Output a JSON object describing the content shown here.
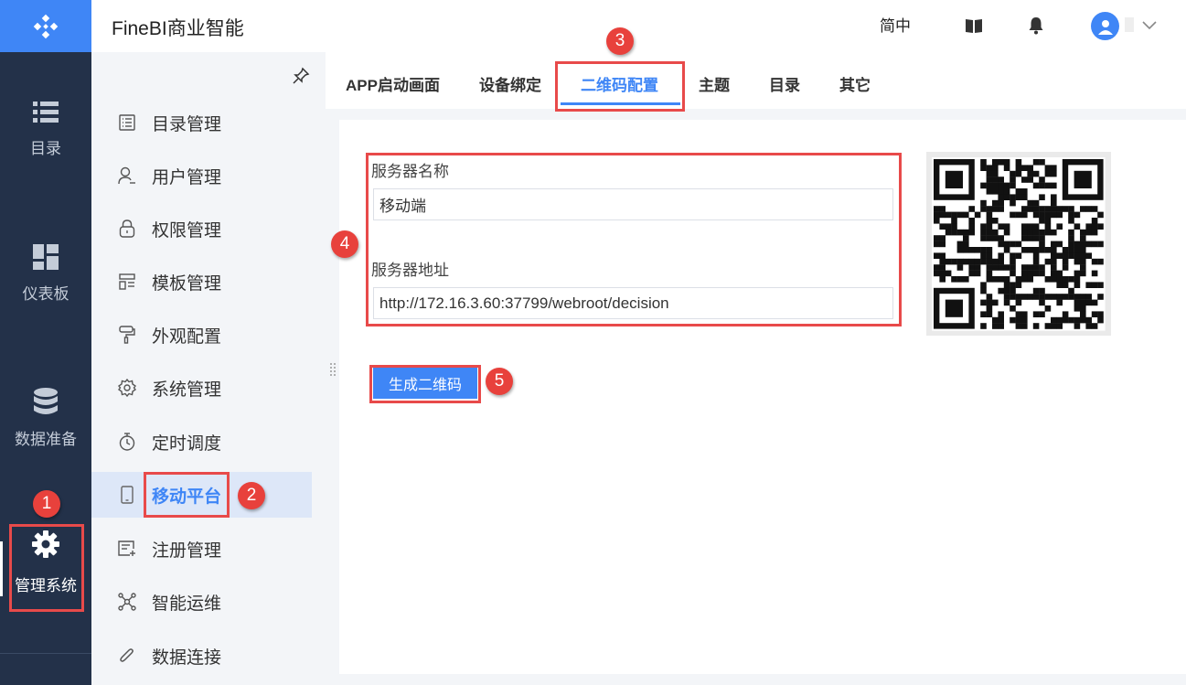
{
  "header": {
    "app_title": "FineBI商业智能",
    "lang": "简中"
  },
  "rail": {
    "items": [
      {
        "label": "目录",
        "icon": "list-icon"
      },
      {
        "label": "仪表板",
        "icon": "dashboard-icon"
      },
      {
        "label": "数据准备",
        "icon": "database-icon"
      },
      {
        "label": "管理系统",
        "icon": "gear-icon"
      }
    ]
  },
  "sidebar": {
    "items": [
      {
        "label": "目录管理",
        "icon": "catalog-icon"
      },
      {
        "label": "用户管理",
        "icon": "user-icon"
      },
      {
        "label": "权限管理",
        "icon": "lock-icon"
      },
      {
        "label": "模板管理",
        "icon": "template-icon"
      },
      {
        "label": "外观配置",
        "icon": "paint-roller-icon"
      },
      {
        "label": "系统管理",
        "icon": "settings-icon"
      },
      {
        "label": "定时调度",
        "icon": "timer-icon"
      },
      {
        "label": "移动平台",
        "icon": "mobile-icon"
      },
      {
        "label": "注册管理",
        "icon": "register-icon"
      },
      {
        "label": "智能运维",
        "icon": "network-icon"
      },
      {
        "label": "数据连接",
        "icon": "paperclip-icon"
      }
    ]
  },
  "tabs": [
    {
      "label": "APP启动画面"
    },
    {
      "label": "设备绑定"
    },
    {
      "label": "二维码配置"
    },
    {
      "label": "主题"
    },
    {
      "label": "目录"
    },
    {
      "label": "其它"
    }
  ],
  "form": {
    "server_name_label": "服务器名称",
    "server_name_value": "移动端",
    "server_address_label": "服务器地址",
    "server_address_value": "http://172.16.3.60:37799/webroot/decision",
    "generate_button": "生成二维码"
  },
  "badges": [
    "1",
    "2",
    "3",
    "4",
    "5"
  ],
  "colors": {
    "accent": "#3f86f6",
    "rail_bg": "#233149",
    "annotation_red": "#e84a4a"
  }
}
